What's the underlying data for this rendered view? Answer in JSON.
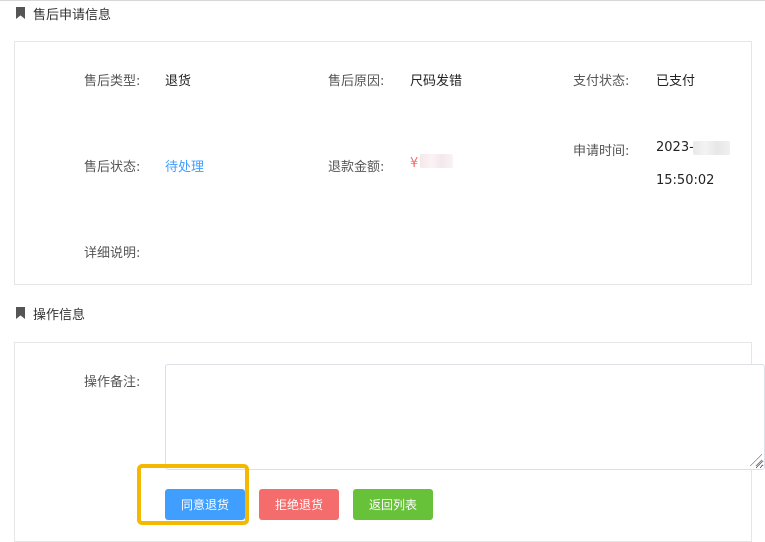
{
  "apply_section": {
    "title": "售后申请信息",
    "fields": {
      "type_label": "售后类型:",
      "type_value": "退货",
      "reason_label": "售后原因:",
      "reason_value": "尺码发错",
      "pay_label": "支付状态:",
      "pay_value": "已支付",
      "status_label": "售后状态:",
      "status_value": "待处理",
      "refund_label": "退款金额:",
      "refund_value": "¥",
      "time_label": "申请时间:",
      "time_date_prefix": "2023-",
      "time_clock": "15:50:02",
      "detail_label": "详细说明:"
    }
  },
  "operation_section": {
    "title": "操作信息",
    "remark_label": "操作备注:",
    "remark_value": ""
  },
  "buttons": {
    "agree": "同意退货",
    "reject": "拒绝退货",
    "back": "返回列表"
  },
  "colors": {
    "link": "#409eff",
    "money": "#f56c6c",
    "agree_button": "#409eff",
    "reject_button": "#f56c6c",
    "back_button": "#67c23a",
    "highlight_box": "#f5b800"
  }
}
